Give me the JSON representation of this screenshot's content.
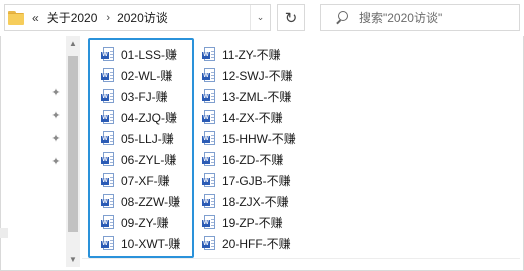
{
  "address": {
    "overflow": "«",
    "crumbs": [
      "关于2020",
      "2020访谈"
    ],
    "separator": "›",
    "dropdown": "⌄"
  },
  "refresh_glyph": "↻",
  "search": {
    "placeholder": "搜索\"2020访谈\""
  },
  "nav": {
    "pin_glyph": "📌"
  },
  "files": {
    "column1": [
      "01-LSS-赚",
      "02-WL-赚",
      "03-FJ-赚",
      "04-ZJQ-赚",
      "05-LLJ-赚",
      "06-ZYL-赚",
      "07-XF-赚",
      "08-ZZW-赚",
      "09-ZY-赚",
      "10-XWT-赚"
    ],
    "column2": [
      "11-ZY-不赚",
      "12-SWJ-不赚",
      "13-ZML-不赚",
      "14-ZX-不赚",
      "15-HHW-不赚",
      "16-ZD-不赚",
      "17-GJB-不赚",
      "18-ZJX-不赚",
      "19-ZP-不赚",
      "20-HFF-不赚"
    ],
    "icon": "word-document-icon",
    "icon_letter": "W"
  },
  "colors": {
    "selection": "#2a92da",
    "word_blue": "#2b5bb5"
  }
}
